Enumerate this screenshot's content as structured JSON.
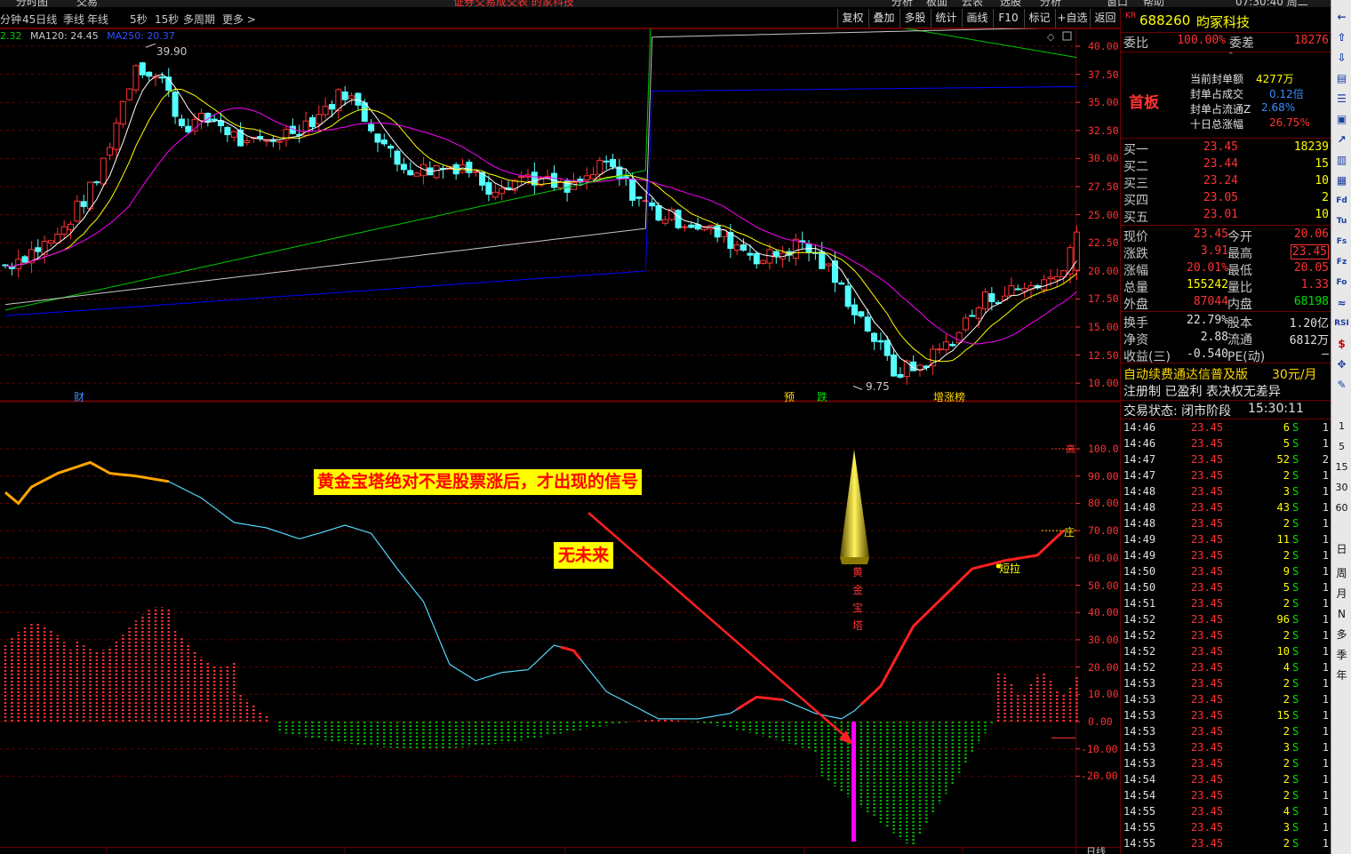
{
  "top_menu": [
    "分时图",
    "交易",
    "证券交易成交表 的家科技",
    "分析",
    "板面",
    "云表",
    "选股",
    "分析",
    "窗口",
    "帮助"
  ],
  "top_clock": "07:30:40 周二",
  "period_tabs": [
    "分钟",
    "45日线",
    "季线",
    "年线",
    "5秒",
    "15秒",
    "多周期",
    "更多 >"
  ],
  "toolbar": [
    "复权",
    "叠加",
    "多股",
    "统计",
    "画线",
    "F10",
    "标记",
    "+自选",
    "返回"
  ],
  "ma_legend": {
    "ma60": "2.32",
    "ma120": "MA120: 24.45",
    "ma250": "MA250: 20.37"
  },
  "price_axis": [
    "40.00",
    "37.50",
    "35.00",
    "32.50",
    "30.00",
    "27.50",
    "25.00",
    "22.50",
    "20.00",
    "17.50",
    "15.00",
    "12.50",
    "10.00"
  ],
  "indicator_axis": [
    "100.0",
    "90.00",
    "80.00",
    "70.00",
    "60.00",
    "50.00",
    "40.00",
    "30.00",
    "20.00",
    "10.00",
    "0.00",
    "-10.00",
    "-20.00"
  ],
  "high_label": "39.90",
  "low_label": "9.75",
  "event_markers": [
    {
      "text": "财",
      "color": "#3c8cff"
    },
    {
      "text": "预",
      "color": "#ffd700"
    },
    {
      "text": "跌",
      "color": "#00e000"
    },
    {
      "text": "增涨榜",
      "color": "#ffd700"
    }
  ],
  "ind_markers": {
    "high": "高",
    "zhuang": "庄",
    "duanla": "短拉",
    "tower": "黄金宝塔"
  },
  "notes": {
    "note1": "黄金宝塔绝对不是股票涨后，才出现的信号",
    "note2": "无未来"
  },
  "stock": {
    "code": "688260",
    "name": "昀冢科技",
    "tag": "KR"
  },
  "weibi": {
    "label": "委比",
    "value": "100.00%",
    "label2": "委差",
    "value2": "18276"
  },
  "seal": {
    "badge": "首板",
    "lines": [
      {
        "label": "当前封单额",
        "value": "4277万"
      },
      {
        "label": "封单占成交",
        "value": "0.12倍"
      },
      {
        "label": "封单占流通Z",
        "value": "2.68%"
      },
      {
        "label": "十日总涨幅",
        "value": "26.75%"
      }
    ]
  },
  "bids": [
    {
      "label": "买一",
      "price": "23.45",
      "vol": "18239"
    },
    {
      "label": "买二",
      "price": "23.44",
      "vol": "15"
    },
    {
      "label": "买三",
      "price": "23.24",
      "vol": "10"
    },
    {
      "label": "买四",
      "price": "23.05",
      "vol": "2"
    },
    {
      "label": "买五",
      "price": "23.01",
      "vol": "10"
    }
  ],
  "quote": [
    {
      "l1": "现价",
      "v1": "23.45",
      "c1": "#ff3232",
      "l2": "今开",
      "v2": "20.06",
      "c2": "#ff3232"
    },
    {
      "l1": "涨跌",
      "v1": "3.91",
      "c1": "#ff3232",
      "l2": "最高",
      "v2": "23.45",
      "c2": "#ff3232"
    },
    {
      "l1": "涨幅",
      "v1": "20.01%",
      "c1": "#ff3232",
      "l2": "最低",
      "v2": "20.05",
      "c2": "#ff3232"
    },
    {
      "l1": "总量",
      "v1": "155242",
      "c1": "#ffff00",
      "l2": "量比",
      "v2": "1.33",
      "c2": "#ff3232"
    },
    {
      "l1": "外盘",
      "v1": "87044",
      "c1": "#ff3232",
      "l2": "内盘",
      "v2": "68198",
      "c2": "#00e000"
    }
  ],
  "fund": [
    {
      "l1": "换手",
      "v1": "22.79%",
      "l2": "股本",
      "v2": "1.20亿"
    },
    {
      "l1": "净资",
      "v1": "2.88",
      "l2": "流通",
      "v2": "6812万"
    },
    {
      "l1": "收益(三)",
      "v1": "-0.540",
      "l2": "PE(动)",
      "v2": "—"
    }
  ],
  "promo": {
    "line1": "自动续费通达信普及版",
    "price": "30元/月",
    "line2": "注册制 已盈利 表决权无差异"
  },
  "trade_state": {
    "label": "交易状态: 闭市阶段",
    "time": "15:30:11"
  },
  "ticks": [
    [
      "14:46",
      "23.45",
      "6",
      "S",
      "1"
    ],
    [
      "14:46",
      "23.45",
      "5",
      "S",
      "1"
    ],
    [
      "14:47",
      "23.45",
      "52",
      "S",
      "2"
    ],
    [
      "14:47",
      "23.45",
      "2",
      "S",
      "1"
    ],
    [
      "14:48",
      "23.45",
      "3",
      "S",
      "1"
    ],
    [
      "14:48",
      "23.45",
      "43",
      "S",
      "1"
    ],
    [
      "14:48",
      "23.45",
      "2",
      "S",
      "1"
    ],
    [
      "14:49",
      "23.45",
      "11",
      "S",
      "1"
    ],
    [
      "14:49",
      "23.45",
      "2",
      "S",
      "1"
    ],
    [
      "14:50",
      "23.45",
      "9",
      "S",
      "1"
    ],
    [
      "14:50",
      "23.45",
      "5",
      "S",
      "1"
    ],
    [
      "14:51",
      "23.45",
      "2",
      "S",
      "1"
    ],
    [
      "14:52",
      "23.45",
      "96",
      "S",
      "1"
    ],
    [
      "14:52",
      "23.45",
      "2",
      "S",
      "1"
    ],
    [
      "14:52",
      "23.45",
      "10",
      "S",
      "1"
    ],
    [
      "14:52",
      "23.45",
      "4",
      "S",
      "1"
    ],
    [
      "14:53",
      "23.45",
      "2",
      "S",
      "1"
    ],
    [
      "14:53",
      "23.45",
      "2",
      "S",
      "1"
    ],
    [
      "14:53",
      "23.45",
      "15",
      "S",
      "1"
    ],
    [
      "14:53",
      "23.45",
      "2",
      "S",
      "1"
    ],
    [
      "14:53",
      "23.45",
      "3",
      "S",
      "1"
    ],
    [
      "14:53",
      "23.45",
      "2",
      "S",
      "1"
    ],
    [
      "14:54",
      "23.45",
      "2",
      "S",
      "1"
    ],
    [
      "14:54",
      "23.45",
      "2",
      "S",
      "1"
    ],
    [
      "14:55",
      "23.45",
      "4",
      "S",
      "1"
    ],
    [
      "14:55",
      "23.45",
      "3",
      "S",
      "1"
    ],
    [
      "14:55",
      "23.45",
      "2",
      "S",
      "1"
    ]
  ],
  "sidebar_text": [
    "1",
    "5",
    "15",
    "30",
    "60",
    "日",
    "周",
    "月",
    "N",
    "多",
    "季",
    "年"
  ],
  "bottom_label": "日线",
  "colors": {
    "up": "#ff3232",
    "down": "#54ffff",
    "ma5": "#ffffff",
    "ma10": "#ffff00",
    "ma20": "#ff00ff",
    "ma60": "#00c800",
    "ma120": "#c8c8c8",
    "ma250": "#0000ff",
    "grid": "#6a0000"
  }
}
